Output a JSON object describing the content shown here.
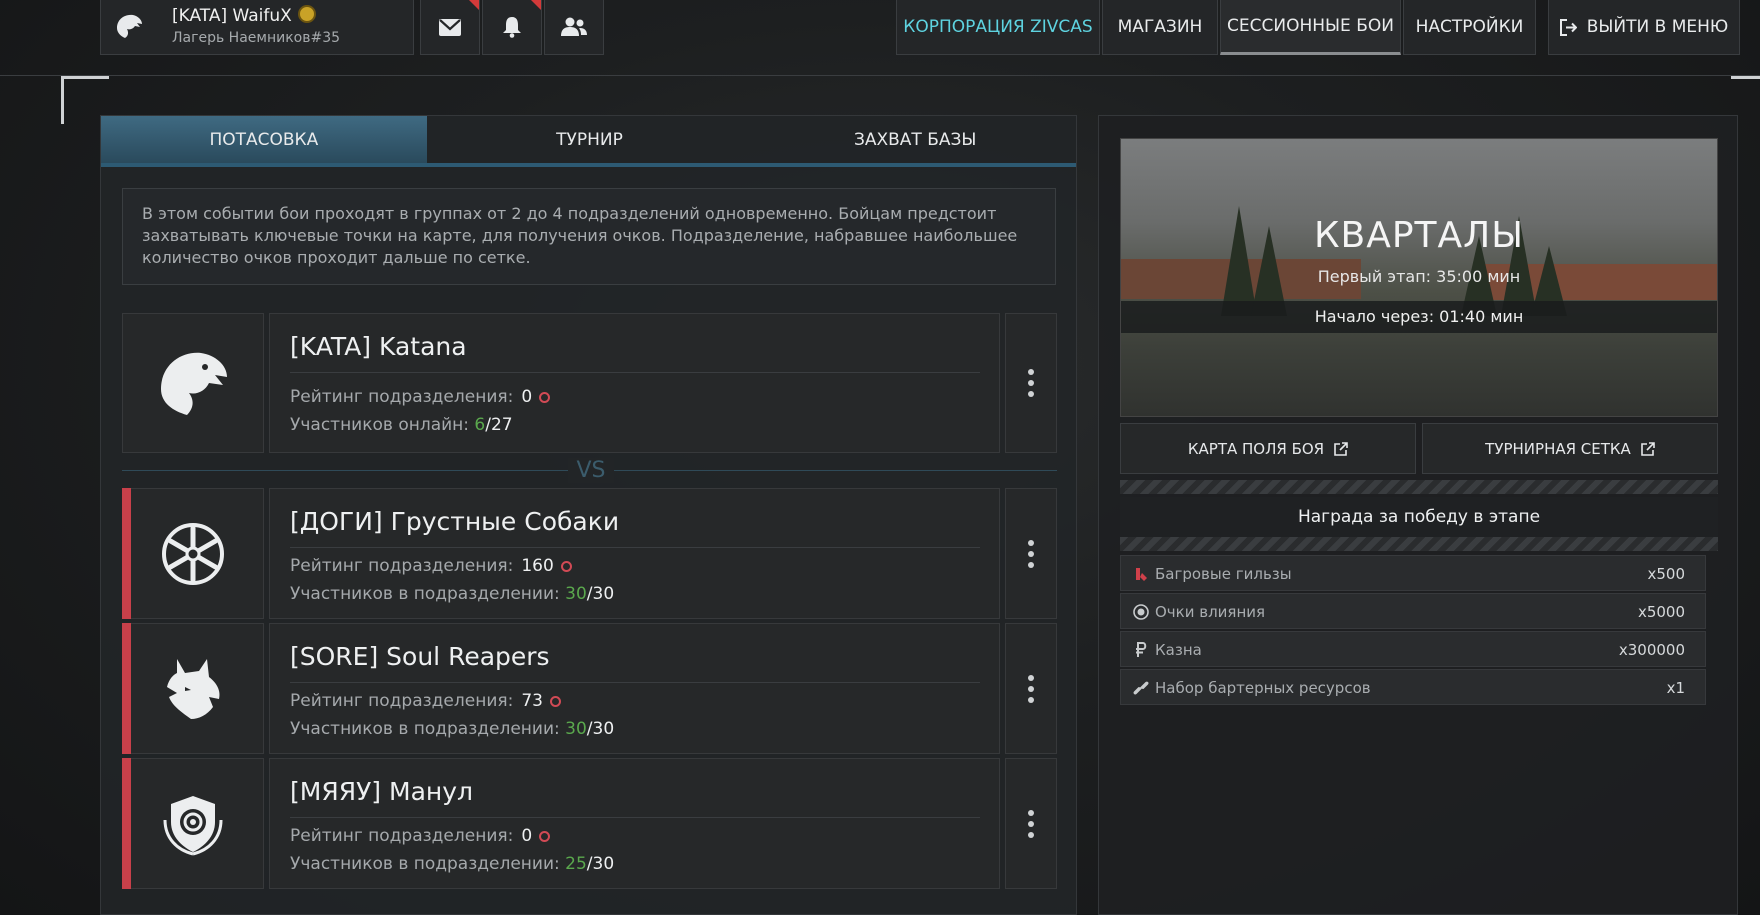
{
  "profile": {
    "name": "[KATA] WaifuX",
    "subtitle": "Лагерь Наемников#35"
  },
  "nav": {
    "corp": "КОРПОРАЦИЯ ZIVCAS",
    "shop": "МАГАЗИН",
    "session": "СЕССИОННЫЕ БОИ",
    "settings": "НАСТРОЙКИ",
    "exit": "ВЫЙТИ В МЕНЮ"
  },
  "tabs": [
    "ПОТАСОВКА",
    "ТУРНИР",
    "ЗАХВАТ БАЗЫ"
  ],
  "description": "В этом событии бои проходят в группах от 2 до 4 подразделений одновременно. Бойцам предстоит захватывать ключевые точки на карте, для получения очков. Подразделение, набравшее наибольшее количество очков проходит дальше по сетке.",
  "vs": "VS",
  "my_team": {
    "name": "[KATA] Katana",
    "rating_label": "Рейтинг подразделения:",
    "rating": "0",
    "members_label": "Участников онлайн:",
    "members_current": "6",
    "members_total": "/27"
  },
  "opponents": [
    {
      "name": "[ДОГИ] Грустные Собаки",
      "rating_label": "Рейтинг подразделения:",
      "rating": "160",
      "members_label": "Участников в подразделении:",
      "members_current": "30",
      "members_total": "/30"
    },
    {
      "name": "[SORE] Soul Reapers",
      "rating_label": "Рейтинг подразделения:",
      "rating": "73",
      "members_label": "Участников в подразделении:",
      "members_current": "30",
      "members_total": "/30"
    },
    {
      "name": "[МЯЯУ] Манул",
      "rating_label": "Рейтинг подразделения:",
      "rating": "0",
      "members_label": "Участников в подразделении:",
      "members_current": "25",
      "members_total": "/30"
    }
  ],
  "map": {
    "title": "КВАРТАЛЫ",
    "stage": "Первый этап: 35:00 мин",
    "start": "Начало через: 01:40 мин"
  },
  "buttons": {
    "battlemap": "КАРТА ПОЛЯ БОЯ",
    "bracket": "ТУРНИРНАЯ СЕТКА"
  },
  "reward": {
    "title": "Награда за победу в этапе",
    "items": [
      {
        "label": "Багровые гильзы",
        "value": "x500",
        "icon": "shells-icon"
      },
      {
        "label": "Очки влияния",
        "value": "x5000",
        "icon": "influence-icon"
      },
      {
        "label": "Казна",
        "value": "x300000",
        "icon": "ruble-icon"
      },
      {
        "label": "Набор бартерных ресурсов",
        "value": "x1",
        "icon": "link-icon"
      }
    ]
  },
  "colors": {
    "accent": "#5ed3e0",
    "active_tab": "#3f6a82",
    "red": "#c8404a",
    "green": "#5aa84d"
  }
}
